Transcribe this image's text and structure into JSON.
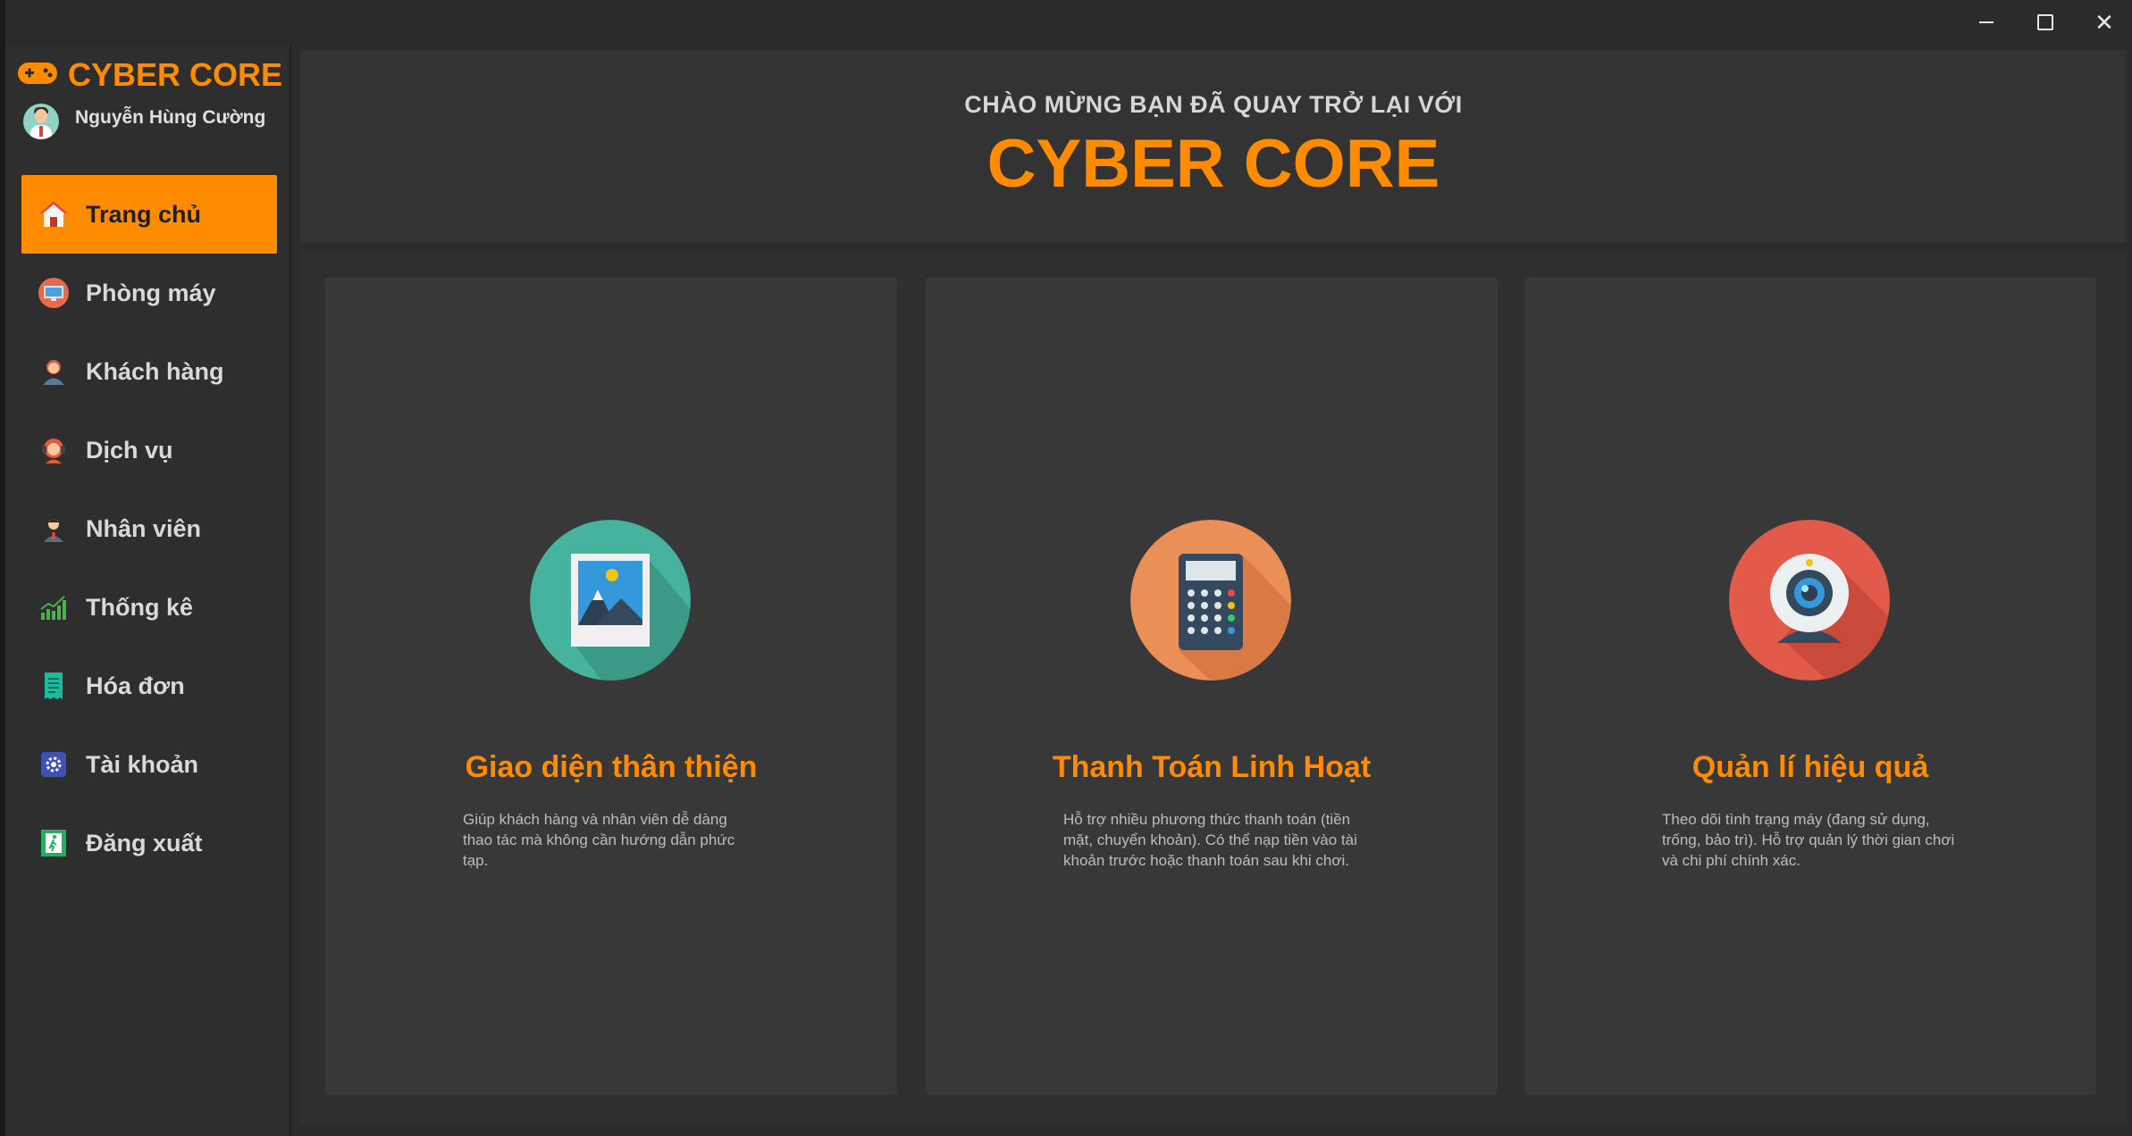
{
  "window": {
    "minimize_icon": "minimize-icon",
    "maximize_icon": "maximize-icon",
    "close_icon": "close-icon",
    "close_glyph": "✕"
  },
  "sidebar": {
    "brand": "CYBER CORE",
    "brand_icon": "gamepad-icon",
    "user_name": "Nguyễn Hùng Cường",
    "items": [
      {
        "label": "Trang chủ",
        "icon": "home-icon",
        "active": true
      },
      {
        "label": "Phòng máy",
        "icon": "computer-room-icon",
        "active": false
      },
      {
        "label": "Khách hàng",
        "icon": "customer-icon",
        "active": false
      },
      {
        "label": "Dịch vụ",
        "icon": "service-icon",
        "active": false
      },
      {
        "label": "Nhân viên",
        "icon": "employee-icon",
        "active": false
      },
      {
        "label": "Thống kê",
        "icon": "statistics-icon",
        "active": false
      },
      {
        "label": "Hóa đơn",
        "icon": "invoice-icon",
        "active": false
      },
      {
        "label": "Tài khoản",
        "icon": "settings-icon",
        "active": false
      },
      {
        "label": "Đăng xuất",
        "icon": "logout-icon",
        "active": false
      }
    ]
  },
  "header": {
    "welcome": "CHÀO MỪNG BẠN ĐÃ QUAY TRỞ LẠI VỚI",
    "title": "CYBER CORE"
  },
  "cards": [
    {
      "icon": "picture-icon",
      "title": "Giao diện thân thiện",
      "desc": "Giúp khách hàng và nhân viên dễ dàng thao tác mà không cần hướng dẫn phức tạp."
    },
    {
      "icon": "calculator-icon",
      "title": "Thanh Toán Linh Hoạt",
      "desc": "Hỗ trợ nhiều phương thức thanh toán (tiền mặt, chuyển khoản). Có thể nạp tiền vào tài khoản trước hoặc thanh toán sau khi chơi."
    },
    {
      "icon": "webcam-icon",
      "title": "Quản lí hiệu quả",
      "desc": "Theo dõi tình trạng máy (đang sử dụng, trống, bảo trì). Hỗ trợ quản lý thời gian chơi và chi phí chính xác."
    }
  ],
  "colors": {
    "accent": "#ff8c00",
    "background": "#2b2b2b",
    "card": "#383838"
  }
}
